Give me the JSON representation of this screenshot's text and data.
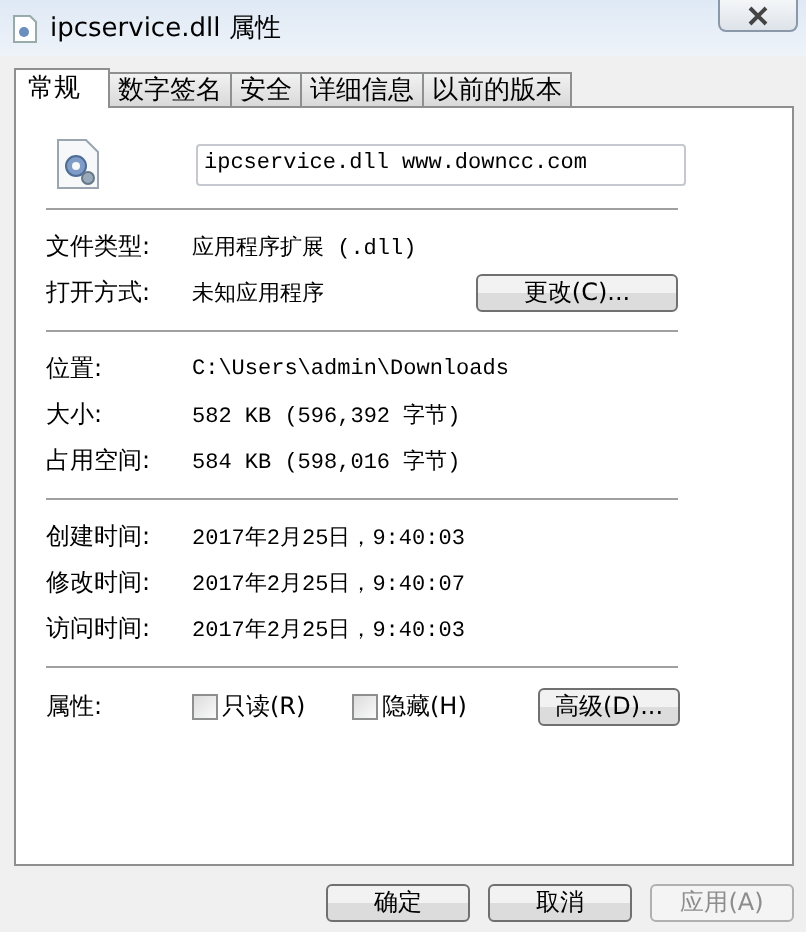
{
  "window": {
    "title": "ipcservice.dll 属性"
  },
  "tabs": [
    {
      "label": "常规",
      "selected": true
    },
    {
      "label": "数字签名",
      "selected": false
    },
    {
      "label": "安全",
      "selected": false
    },
    {
      "label": "详细信息",
      "selected": false
    },
    {
      "label": "以前的版本",
      "selected": false
    }
  ],
  "file_name": {
    "value": "ipcservice.dll www.downcc.com"
  },
  "groups": [
    [
      {
        "label": "文件类型:",
        "value": "应用程序扩展 (.dll)"
      },
      {
        "label": "打开方式:",
        "value": "未知应用程序",
        "button": "更改(C)..."
      }
    ],
    [
      {
        "label": "位置:",
        "value": "C:\\Users\\admin\\Downloads"
      },
      {
        "label": "大小:",
        "value": "582 KB (596,392 字节)"
      },
      {
        "label": "占用空间:",
        "value": "584 KB (598,016 字节)"
      }
    ],
    [
      {
        "label": "创建时间:",
        "value": "2017年2月25日，9:40:03"
      },
      {
        "label": "修改时间:",
        "value": "2017年2月25日，9:40:07"
      },
      {
        "label": "访问时间:",
        "value": "2017年2月25日，9:40:03"
      }
    ]
  ],
  "attributes": {
    "label": "属性:",
    "checkboxes": [
      {
        "label": "只读(R)",
        "checked": false
      },
      {
        "label": "隐藏(H)",
        "checked": false
      }
    ],
    "button": "高级(D)..."
  },
  "buttons": [
    {
      "label": "确定",
      "disabled": false
    },
    {
      "label": "取消",
      "disabled": false
    },
    {
      "label": "应用(A)",
      "disabled": true
    }
  ]
}
